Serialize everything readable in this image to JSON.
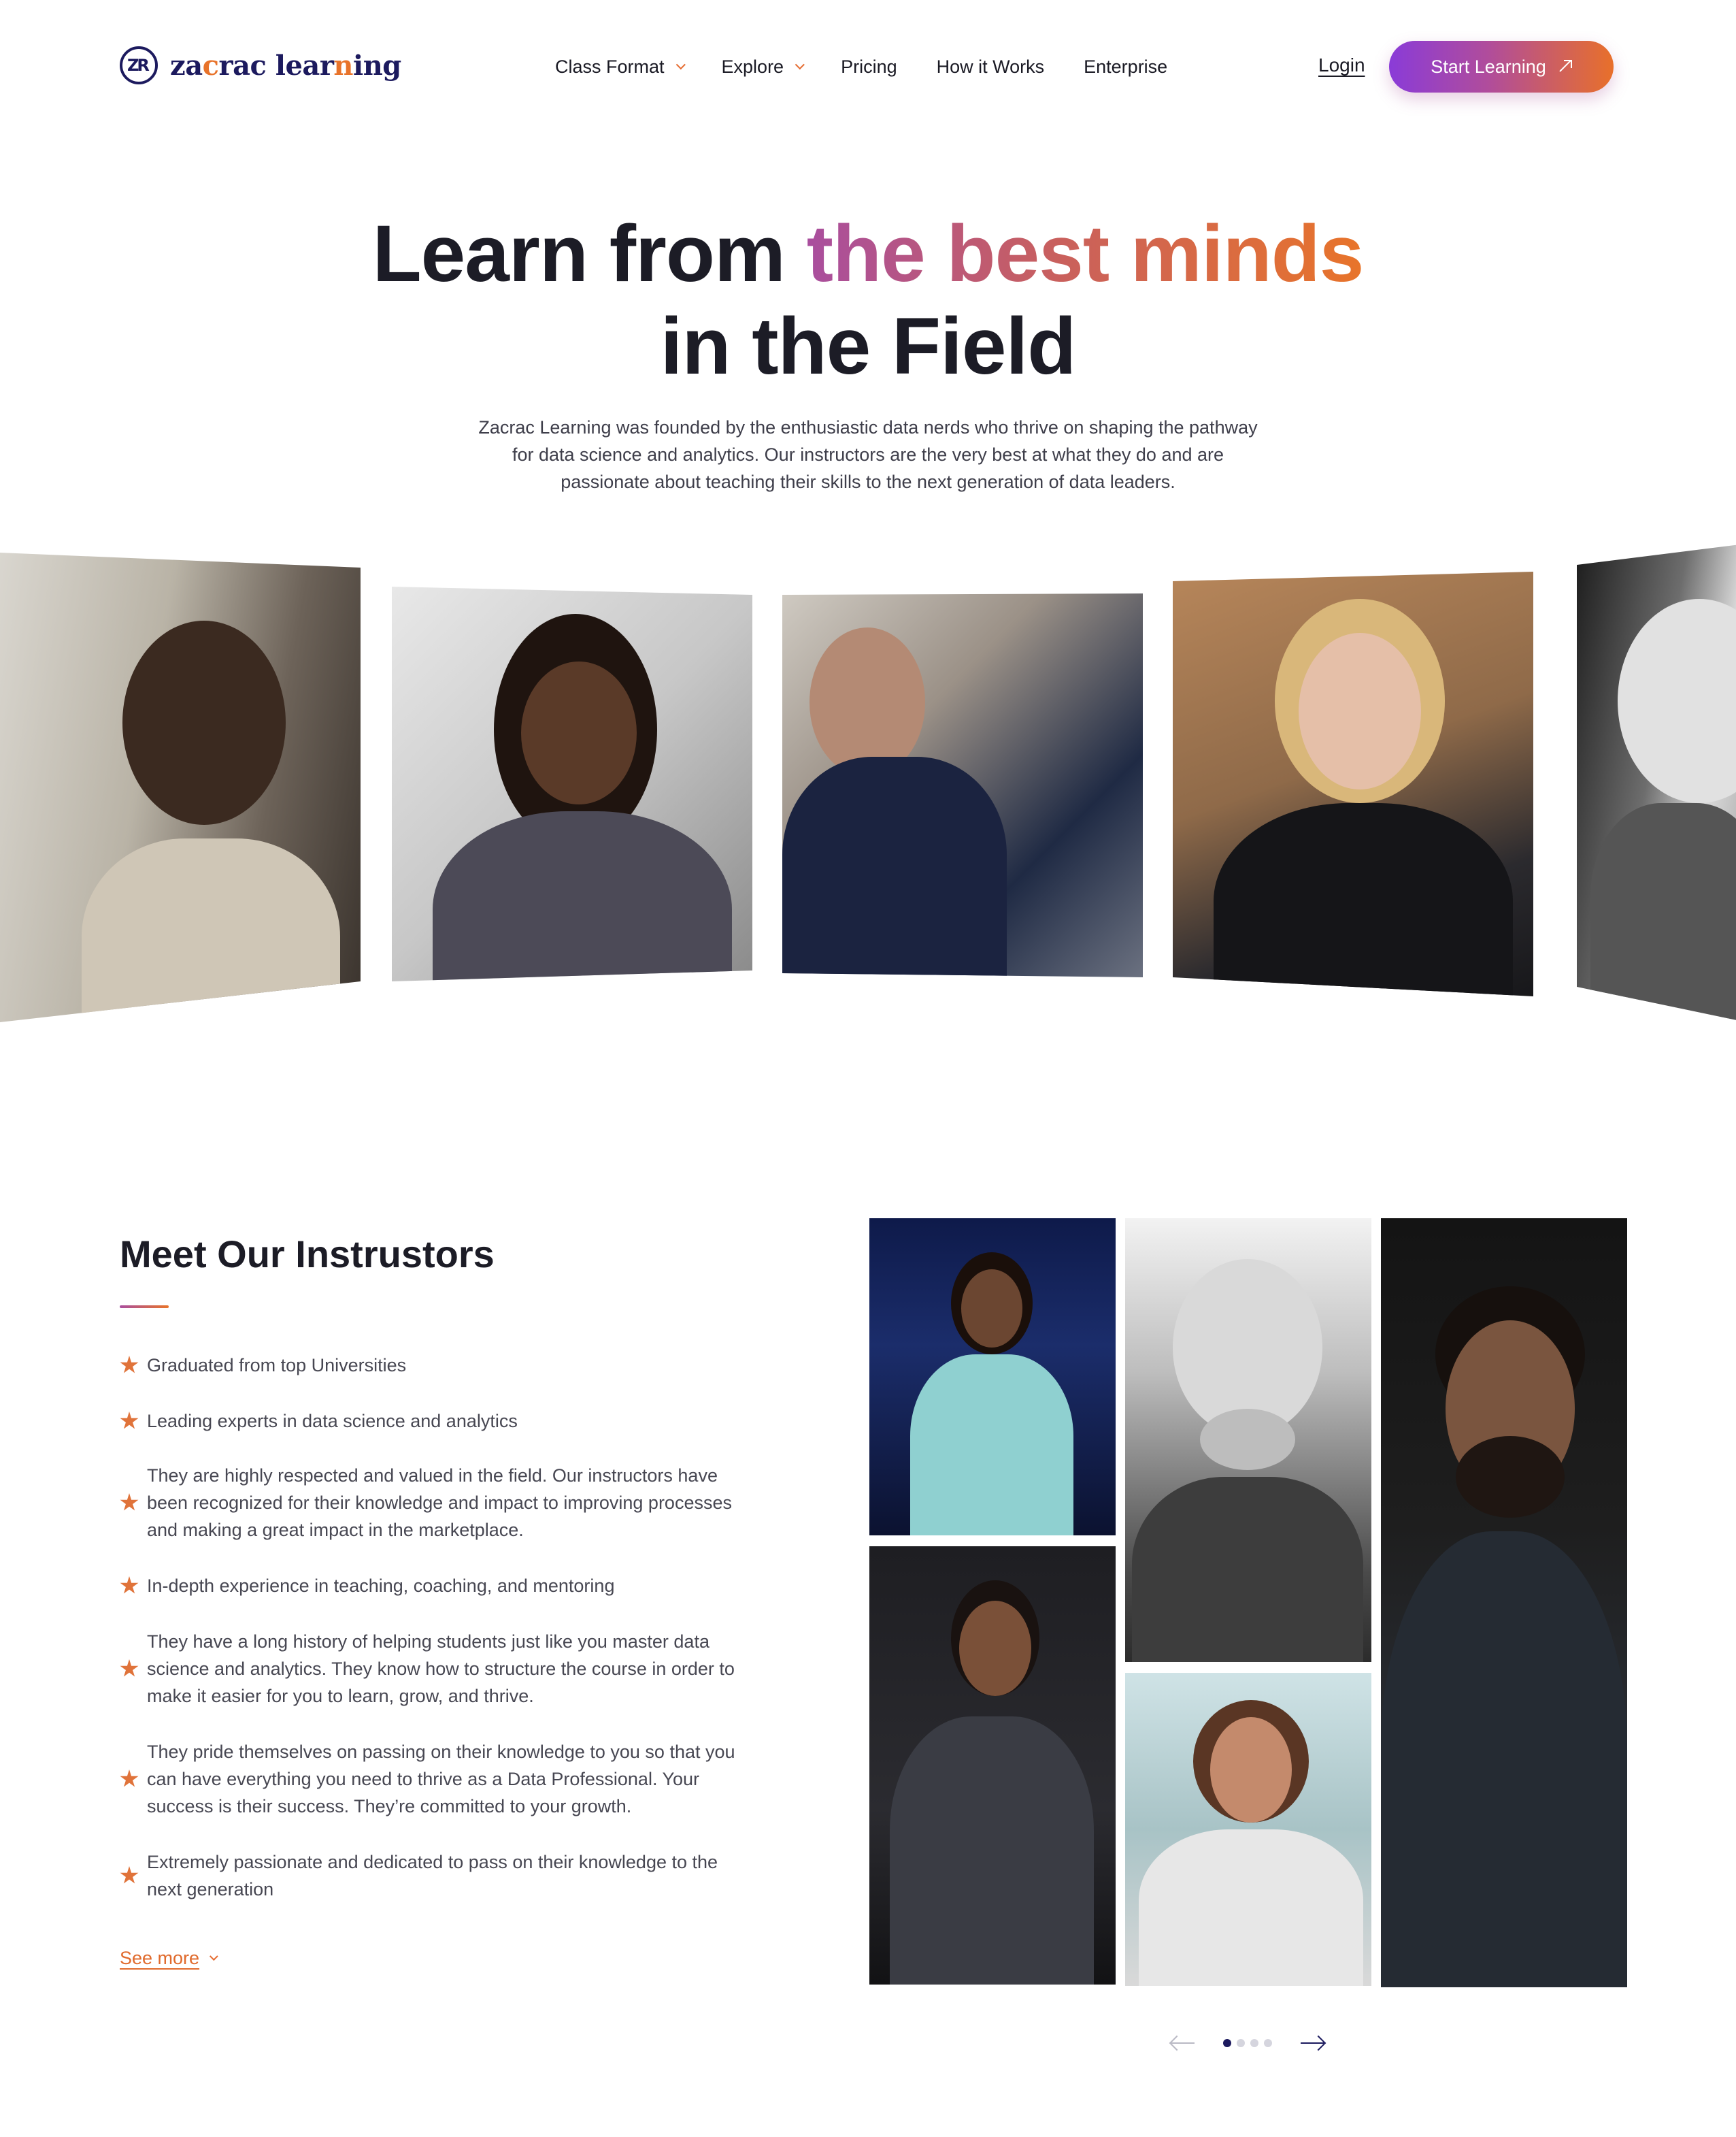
{
  "brand": {
    "name_part1": "za",
    "name_accent": "c",
    "name_part2": "rac lear",
    "name_accent2": "n",
    "name_part3": "ing",
    "logo_initials": "ZR",
    "primary_color": "#1c1a5e",
    "accent_color": "#e8732a"
  },
  "nav": {
    "items": [
      {
        "label": "Class Format",
        "has_dropdown": true
      },
      {
        "label": "Explore",
        "has_dropdown": true
      },
      {
        "label": "Pricing",
        "has_dropdown": false
      },
      {
        "label": "How it Works",
        "has_dropdown": false
      },
      {
        "label": "Enterprise",
        "has_dropdown": false
      }
    ],
    "login_label": "Login",
    "cta_label": "Start Learning"
  },
  "hero": {
    "title_plain_1": "Learn from ",
    "title_gradient": "the best minds",
    "title_plain_2": "in the Field",
    "subtitle": "Zacrac Learning was founded by the enthusiastic data nerds who thrive on shaping the pathway for data science and analytics. Our instructors are the very best at what they do and are passionate about teaching their skills to the next generation of data leaders."
  },
  "instructors": {
    "title": "Meet Our Instrustors",
    "points": [
      "Graduated from top Universities",
      "Leading experts in data science and analytics",
      "They are highly respected and valued in the field. Our instructors have been recognized for their knowledge and impact to improving processes and making a great impact in the marketplace.",
      "In-depth experience in teaching, coaching, and mentoring",
      "They have a long history of helping students just like you master data science and analytics. They know how to structure the course in order to make it easier for you to learn, grow, and thrive.",
      "They pride themselves on passing on their knowledge to you so that you can have everything you need to thrive as a Data Professional. Your success is their success. They’re committed to your growth.",
      "Extremely passionate and dedicated to pass on their knowledge to the next generation"
    ],
    "see_more_label": "See more",
    "carousel": {
      "pages": 4,
      "active_page": 1
    }
  }
}
